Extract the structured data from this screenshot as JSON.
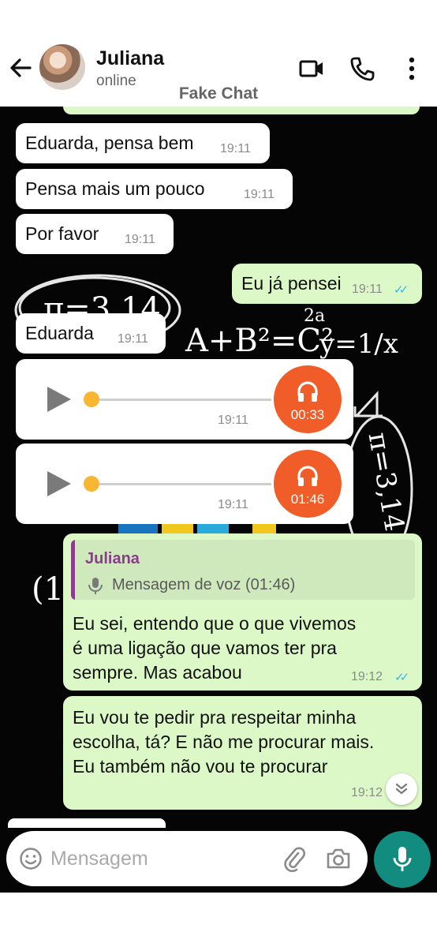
{
  "header": {
    "contact_name": "Juliana",
    "status": "online",
    "watermark": "Fake Chat",
    "icons": [
      "back-arrow-icon",
      "video-call-icon",
      "phone-icon",
      "more-options-icon"
    ]
  },
  "messages": [
    {
      "direction": "in",
      "type": "text",
      "text": "Eduarda, pensa bem",
      "time": "19:11"
    },
    {
      "direction": "in",
      "type": "text",
      "text": "Pensa mais um pouco",
      "time": "19:11"
    },
    {
      "direction": "in",
      "type": "text",
      "text": "Por favor",
      "time": "19:11"
    },
    {
      "direction": "out",
      "type": "text",
      "text": "Eu já pensei",
      "time": "19:11",
      "read": true
    },
    {
      "direction": "in",
      "type": "text",
      "text": "Eduarda",
      "time": "19:11"
    },
    {
      "direction": "in",
      "type": "voice",
      "duration": "00:33",
      "time": "19:11",
      "progress": 0
    },
    {
      "direction": "in",
      "type": "voice",
      "duration": "01:46",
      "time": "19:11",
      "progress": 0
    },
    {
      "direction": "out",
      "type": "reply",
      "quote_author": "Juliana",
      "quote_text": "Mensagem de voz (01:46)",
      "lines": [
        "Eu sei, entendo que o que vivemos",
        "é uma ligação que vamos ter pra",
        "sempre. Mas acabou"
      ],
      "time": "19:12",
      "read": true
    },
    {
      "direction": "out",
      "type": "text",
      "lines": [
        "Eu vou te pedir pra respeitar minha",
        "escolha, tá? E não me procurar mais.",
        "Eu também não vou te procurar"
      ],
      "time": "19:12"
    }
  ],
  "background_chalk": {
    "pi": "π=3,14",
    "equation_1": "A+B²=C²",
    "exponent": "2a",
    "equation_2": "y=1/x",
    "pi_rotated": "π=3,14",
    "fragment": "(1-"
  },
  "composer": {
    "placeholder": "Mensagem",
    "icons": [
      "emoji-icon",
      "attach-icon",
      "camera-icon",
      "mic-icon"
    ]
  },
  "colors": {
    "incoming_bubble": "#ffffff",
    "outgoing_bubble": "#dcf8c6",
    "voice_accent": "#f15d28",
    "mic_button": "#128c7e",
    "read_ticks": "#34b7f1",
    "quote_author": "#8a3d8c"
  }
}
